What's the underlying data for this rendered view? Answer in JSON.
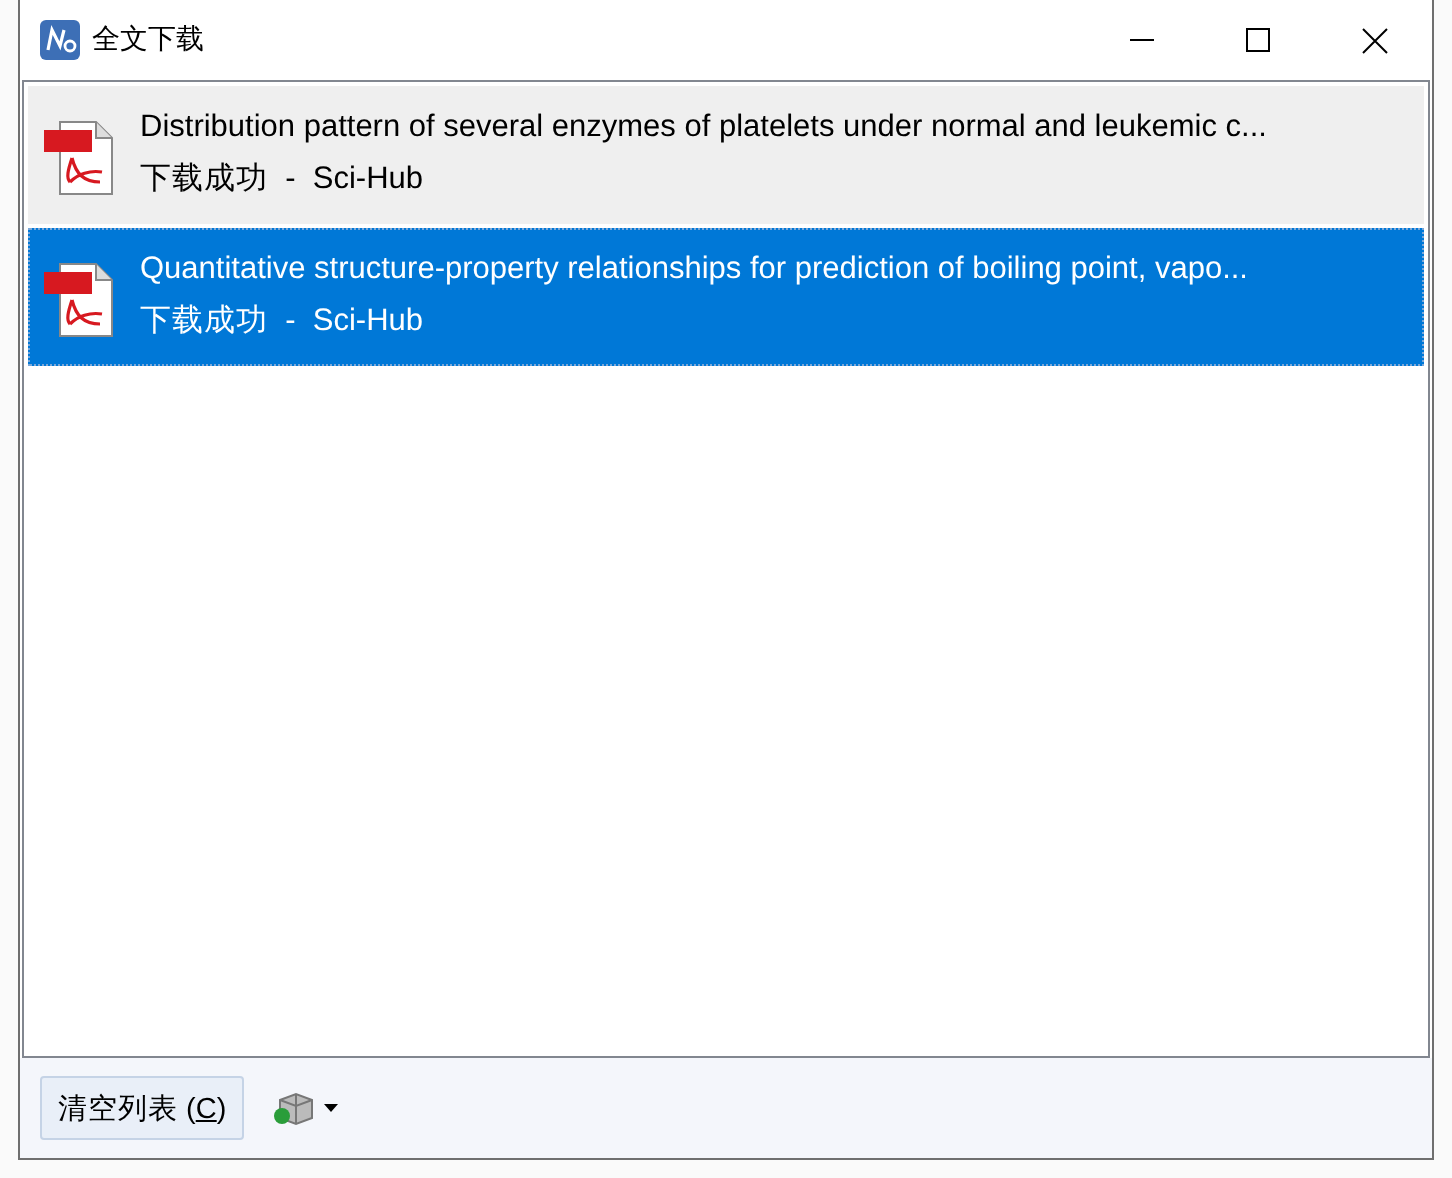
{
  "window": {
    "title": "全文下载"
  },
  "downloads": [
    {
      "title": "Distribution pattern of several enzymes of platelets under normal and leukemic  c...",
      "status_line": "下载成功  -  Sci-Hub",
      "selected": false
    },
    {
      "title": "Quantitative structure-property relationships for prediction of boiling point,  vapo...",
      "status_line": "下载成功  -  Sci-Hub",
      "selected": true
    }
  ],
  "footer": {
    "clear_button": {
      "label_before": "清空列表 (",
      "accesskey": "C",
      "label_after": ")"
    }
  }
}
